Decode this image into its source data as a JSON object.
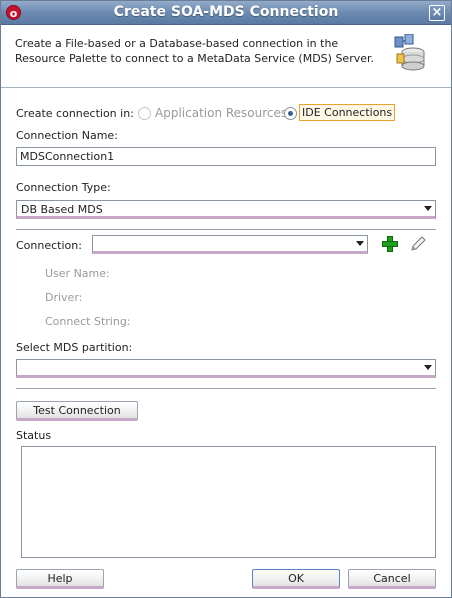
{
  "window": {
    "title": "Create SOA-MDS Connection",
    "close_glyph": "×",
    "app_icon_glyph": "o"
  },
  "header": {
    "description": "Create a File-based or a Database-based connection in the Resource Palette to connect to a MetaData Service (MDS) Server."
  },
  "create_in": {
    "label": "Create connection in:",
    "options": [
      {
        "label": "Application Resources",
        "selected": false,
        "enabled": false
      },
      {
        "label": "IDE Connections",
        "selected": true,
        "enabled": true
      }
    ]
  },
  "connection_name": {
    "label": "Connection Name:",
    "value": "MDSConnection1"
  },
  "connection_type": {
    "label": "Connection Type:",
    "value": "DB Based MDS"
  },
  "connection": {
    "label": "Connection:",
    "value": "",
    "details": [
      "User Name:",
      "Driver:",
      "Connect String:"
    ]
  },
  "mds_partition": {
    "label": "Select MDS partition:",
    "value": ""
  },
  "buttons": {
    "test_connection": "Test Connection",
    "help": "Help",
    "ok": "OK",
    "cancel": "Cancel"
  },
  "status": {
    "label": "Status",
    "text": ""
  },
  "colors": {
    "titlebar": "#6f8cb3",
    "combo_accent": "#c7a7c8",
    "add_icon": "#1e9e1e"
  },
  "icons": [
    "oracle-app-icon",
    "close-icon",
    "database-connection-icon",
    "add-icon",
    "edit-pencil-icon",
    "dropdown-arrow-icon"
  ]
}
